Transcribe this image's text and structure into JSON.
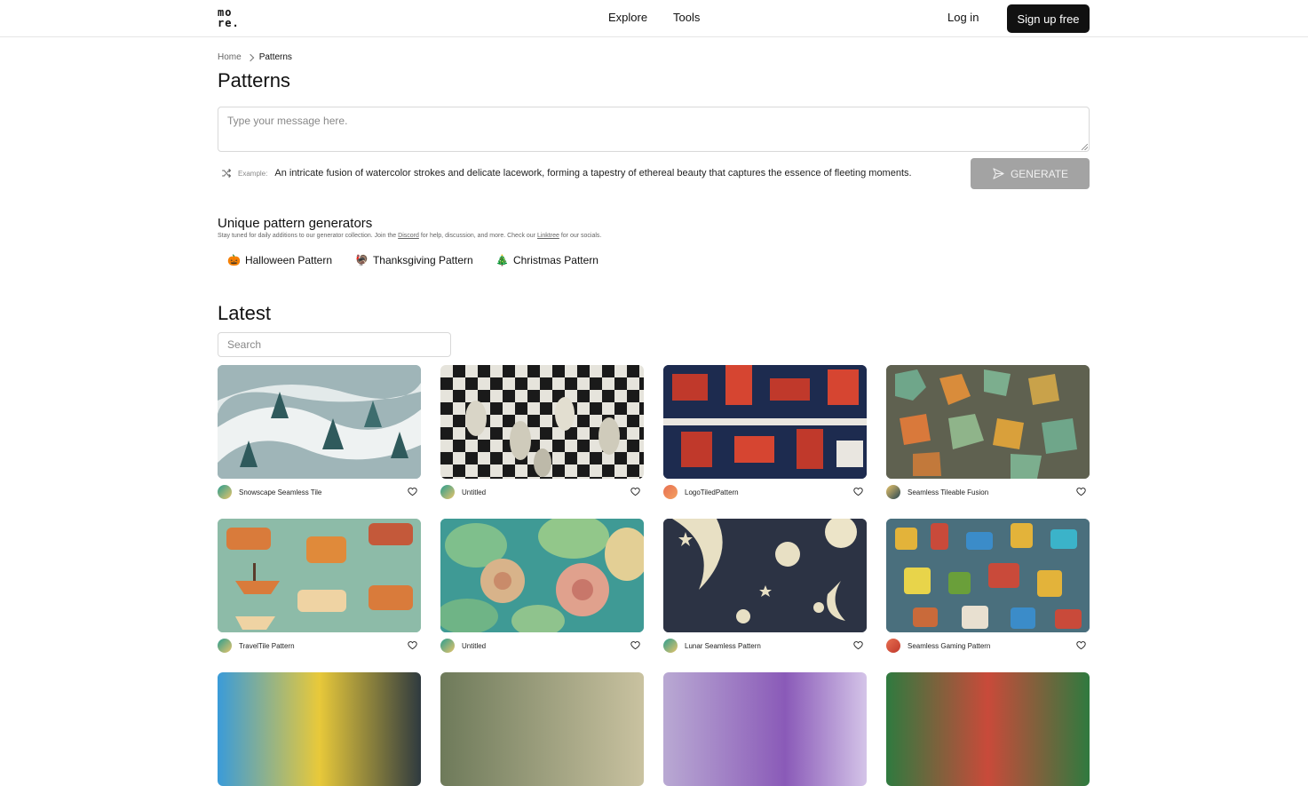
{
  "header": {
    "logo": "mo re.",
    "nav": [
      "Explore",
      "Tools"
    ],
    "login": "Log in",
    "signup": "Sign up free"
  },
  "breadcrumb": {
    "home": "Home",
    "current": "Patterns"
  },
  "page_title": "Patterns",
  "prompt": {
    "placeholder": "Type your message here.",
    "example_label": "Example:",
    "example_text": "An intricate fusion of watercolor strokes and delicate lacework, forming a tapestry of ethereal beauty that captures the essence of fleeting moments.",
    "generate_label": "GENERATE"
  },
  "generators": {
    "title": "Unique pattern generators",
    "sub_before": "Stay tuned for daily additions to our generator collection. Join the",
    "discord": "Discord",
    "sub_mid": "for help, discussion, and more. Check our",
    "linktree": "Linktree",
    "sub_after": "for our socials.",
    "items": [
      {
        "emoji": "🎃",
        "label": "Halloween Pattern"
      },
      {
        "emoji": "🦃",
        "label": "Thanksgiving Pattern"
      },
      {
        "emoji": "🎄",
        "label": "Christmas Pattern"
      }
    ]
  },
  "latest": {
    "title": "Latest",
    "search_placeholder": "Search",
    "cards": [
      {
        "name": "Snowscape Seamless Tile"
      },
      {
        "name": "Untitled"
      },
      {
        "name": "LogoTiledPattern"
      },
      {
        "name": "Seamless Tileable Fusion"
      },
      {
        "name": "TravelTile Pattern"
      },
      {
        "name": "Untitled"
      },
      {
        "name": "Lunar Seamless Pattern"
      },
      {
        "name": "Seamless Gaming Pattern"
      }
    ]
  },
  "icons": [
    "shuffle-icon",
    "send-icon",
    "heart-icon",
    "chevron-right-icon"
  ]
}
